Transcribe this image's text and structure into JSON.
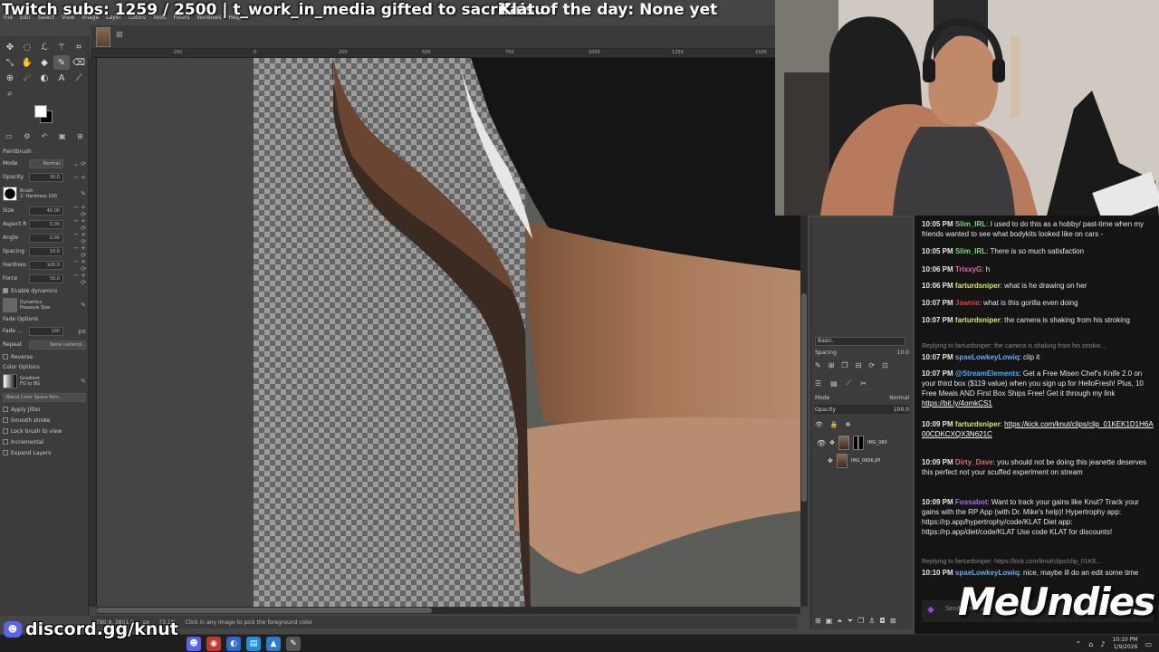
{
  "overlay": {
    "subs_text": "Twitch subs: 1259 / 2500 | t_work_in_media gifted to sacrifaisu",
    "klat_text": "Klat of the day: None yet"
  },
  "gimp": {
    "menus": [
      "File",
      "Edit",
      "Select",
      "View",
      "Image",
      "Layer",
      "Colors",
      "Tools",
      "Filters",
      "Windows",
      "Help"
    ],
    "ruler_marks": [
      "-250",
      "0",
      "250",
      "500",
      "750",
      "1000",
      "1250",
      "1500"
    ],
    "tool_options": {
      "title": "Paintbrush",
      "mode_label": "Mode",
      "mode_value": "Normal",
      "opacity_label": "Opacity",
      "opacity_value": "30.0",
      "brush_label": "Brush",
      "brush_value": "2. Hardness 100",
      "size_label": "Size",
      "size_value": "40.00",
      "aspect_label": "Aspect Ra...",
      "aspect_value": "0.00",
      "angle_label": "Angle",
      "angle_value": "0.00",
      "spacing_label": "Spacing",
      "spacing_value": "10.0",
      "hardness_label": "Hardness",
      "hardness_value": "100.0",
      "force_label": "Force",
      "force_value": "50.0",
      "dynamics_enable": "Enable dynamics",
      "dynamics_label": "Dynamics",
      "dynamics_value": "Pressure Size",
      "fade_options": "Fade Options",
      "fade_length_label": "Fade ...",
      "fade_length_value": "100",
      "fade_unit": "px",
      "repeat_label": "Repeat",
      "repeat_value": "None (extend)",
      "reverse_label": "Reverse",
      "color_options": "Color Options",
      "gradient_label": "Gradient",
      "gradient_value": "FG to BG",
      "blend_space": "Blend Color Space Perc...",
      "apply_jitter": "Apply Jitter",
      "smooth_stroke": "Smooth stroke",
      "lock_brush": "Lock brush to view",
      "incremental": "Incremental",
      "expand_layers": "Expand Layers"
    },
    "status": {
      "coords": "780.9, 3851.0",
      "unit": "px",
      "zoom": "73.1%",
      "message": "Click in any image to pick the foreground color"
    },
    "dock": {
      "brush_preset": "Basic.",
      "spacing_label": "Spacing",
      "spacing_value": "10.0",
      "mode_label": "Mode",
      "mode_value": "Normal",
      "opacity_label": "Opacity",
      "opacity_value": "100.0",
      "layers": [
        {
          "name": "IMG_060"
        },
        {
          "name": "IMG_0606.JPI"
        }
      ]
    }
  },
  "chat": {
    "messages": [
      {
        "time": "10:05 PM",
        "user": "Slim_IRL",
        "color": "#7dd87d",
        "text": ": I used to do this as a hobby/ past-time when my friends wanted to see what bodykits looked like on cars -"
      },
      {
        "time": "10:05 PM",
        "user": "Slim_IRL",
        "color": "#7dd87d",
        "text": ": There is so much satisfaction"
      },
      {
        "time": "10:06 PM",
        "user": "TrixxyG",
        "color": "#e06aa0",
        "text": ": h"
      },
      {
        "time": "10:06 PM",
        "user": "farturdsniper",
        "color": "#d6e86a",
        "text": ": what is he drawing on her"
      },
      {
        "time": "10:07 PM",
        "user": "Jawnie",
        "color": "#e04040",
        "text": ": what is this gorilla even doing"
      },
      {
        "time": "10:07 PM",
        "user": "farturdsniper",
        "color": "#d6e86a",
        "text": ": the camera is shaking from his stroking"
      },
      {
        "reply": "Replying to farturdsniper: the camera is shaking from his strokin..."
      },
      {
        "time": "10:07 PM",
        "user": "spaeLowkeyLowiq",
        "color": "#6aa8f0",
        "text": ": clip it"
      },
      {
        "time": "10:07 PM",
        "user": "@StreamElements",
        "color": "#4ab0ff",
        "text": ": Get a Free Misen Chef's Knife 2.0 on your third box ($119 value) when you sign up for HelloFresh! Plus, 10 Free Meals AND First Box Ships Free! Get it through my link ",
        "link": "https://bit.ly/4omkCS1"
      },
      {
        "time": "10:09 PM",
        "user": "farturdsniper",
        "color": "#d6e86a",
        "text": ": ",
        "link": "https://kick.com/knut/clips/clip_01KEK1D1H6A00CDKCXQX3N621C"
      },
      {
        "time": "10:09 PM",
        "user": "Dirty_Dave",
        "color": "#e06a6a",
        "text": ": you should not be doing this jeanette deserves this perfect not your scuffed experiment on stream"
      },
      {
        "time": "10:09 PM",
        "user": "Fossabot",
        "color": "#b06af0",
        "text": ": Want to track your gains like Knut? Track your gains with the RP App (with Dr. Mike's help)! Hypertrophy app: https://rp.app/hypertrophy/code/KLAT Diet app: https://rp.app/diet/code/KLAT Use code KLAT for discounts!"
      },
      {
        "reply": "Replying to farturdsniper: https://kick.com/knut/clips/clip_01KE..."
      },
      {
        "time": "10:10 PM",
        "user": "spaeLowkeyLowiq",
        "color": "#6aa8f0",
        "text": ": nice, maybe ill do an edit some time"
      }
    ],
    "input_placeholder": "Send a message"
  },
  "sponsor": "MeUndies",
  "discord": "discord.gg/knut",
  "taskbar": {
    "time": "10:10 PM",
    "date": "1/9/2026"
  }
}
